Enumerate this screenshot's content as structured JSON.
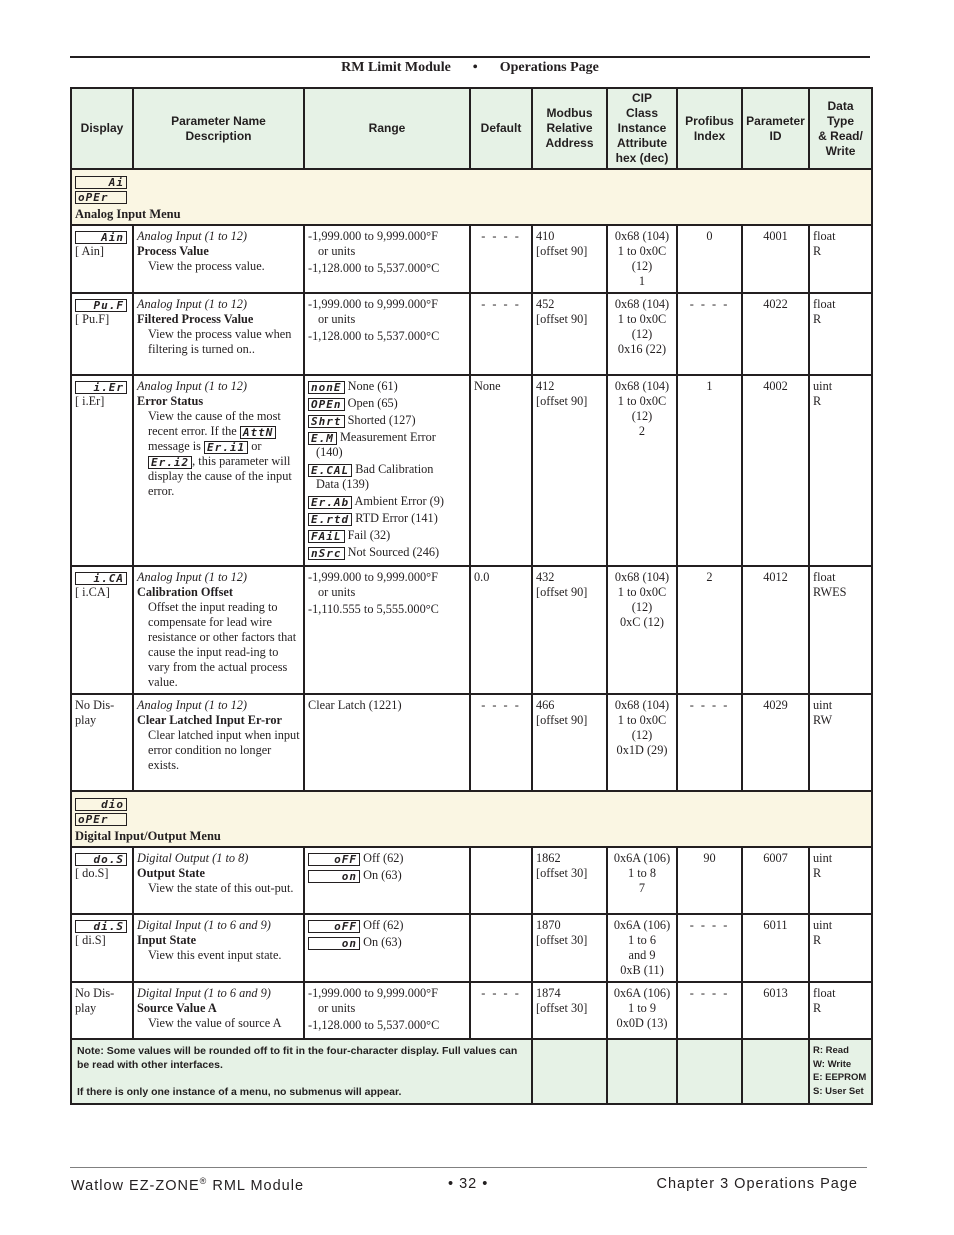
{
  "header": {
    "module": "RM Limit Module",
    "separator": "•",
    "page": "Operations Page"
  },
  "columns": {
    "display": "Display",
    "param_name_line1": "Parameter Name",
    "param_name_line2": "Description",
    "range": "Range",
    "default": "Default",
    "modbus": [
      "Modbus",
      "Relative",
      "Address"
    ],
    "cip": [
      "CIP",
      "Class",
      "Instance",
      "Attribute",
      "hex (dec)"
    ],
    "profibus": [
      "Profibus",
      "Index"
    ],
    "parameter_id": [
      "Parameter",
      "ID"
    ],
    "data_type": [
      "Data",
      "Type",
      "& Read/",
      "Write"
    ]
  },
  "menus": [
    {
      "lcd_top": "Ai",
      "lcd_bottom": "oPEr",
      "title": "Analog Input Menu"
    },
    {
      "lcd_top": "dio",
      "lcd_bottom": "oPEr",
      "title": "Digital Input/Output Menu"
    }
  ],
  "rows": [
    {
      "lcd": "Ain",
      "code": "[ Ain]",
      "group": "Analog Input (1 to 12)",
      "name": "Process Value",
      "desc": "View the process value.",
      "range": [
        "-1,999.000 to 9,999.000°F",
        "or units",
        "-1,128.000 to 5,537.000°C"
      ],
      "default": "- - - -",
      "modbus": [
        "410",
        "[offset 90]"
      ],
      "cip": [
        "0x68 (104)",
        "1 to 0x0C",
        "(12)",
        "1"
      ],
      "profibus": "0",
      "pid": "4001",
      "dtype": [
        "float",
        "R"
      ]
    },
    {
      "lcd": "Pu.F",
      "code": "[ Pu.F]",
      "group": "Analog Input (1 to 12)",
      "name": "Filtered Process Value",
      "desc": "View the process value when filtering is turned on..",
      "range": [
        "-1,999.000 to 9,999.000°F",
        "or units",
        "-1,128.000 to 5,537.000°C"
      ],
      "default": "- - - -",
      "modbus": [
        "452",
        "[offset 90]"
      ],
      "cip": [
        "0x68 (104)",
        "1 to 0x0C",
        "(12)",
        "0x16 (22)"
      ],
      "profibus": "- - - -",
      "pid": "4022",
      "dtype": [
        "float",
        "R"
      ]
    },
    {
      "lcd": "i.Er",
      "code": "[ i.Er]",
      "group": "Analog Input (1 to 12)",
      "name": "Error Status",
      "desc_parts": [
        "View the cause of the most recent error. If the ",
        "AttN",
        " message is ",
        "Er.i1",
        " or ",
        "Er.i2",
        ", this parameter will display the cause of the input error."
      ],
      "options": [
        {
          "lcd": "nonE",
          "label": "None (61)"
        },
        {
          "lcd": "OPEn",
          "label": "Open (65)"
        },
        {
          "lcd": "Shrt",
          "label": "Shorted (127)"
        },
        {
          "lcd": "E.M",
          "label": "Measurement Error",
          "cont": "(140)"
        },
        {
          "lcd": "E.CAL",
          "label": "Bad Calibration",
          "cont": "Data (139)"
        },
        {
          "lcd": "Er.Ab",
          "label": "Ambient Error (9)"
        },
        {
          "lcd": "E.rtd",
          "label": "RTD Error (141)"
        },
        {
          "lcd": "FAiL",
          "label": "Fail (32)"
        },
        {
          "lcd": "nSrc",
          "label": "Not Sourced (246)"
        }
      ],
      "default": "None",
      "modbus": [
        "412",
        "[offset 90]"
      ],
      "cip": [
        "0x68 (104)",
        "1 to 0x0C",
        "(12)",
        "2"
      ],
      "profibus": "1",
      "pid": "4002",
      "dtype": [
        "uint",
        "R"
      ]
    },
    {
      "lcd": "i.CA",
      "code": "[ i.CA]",
      "group": "Analog Input (1 to 12)",
      "name": "Calibration Offset",
      "desc": "Offset the input reading to compensate for lead wire resistance or other factors that cause the input read-ing to vary from the actual process value.",
      "range": [
        "-1,999.000 to 9,999.000°F",
        "or units",
        "-1,110.555 to 5,555.000°C"
      ],
      "default": "0.0",
      "modbus": [
        "432",
        "[offset 90]"
      ],
      "cip": [
        "0x68 (104)",
        "1 to 0x0C",
        "(12)",
        "0xC (12)"
      ],
      "profibus": "2",
      "pid": "4012",
      "dtype": [
        "float",
        "RWES"
      ]
    },
    {
      "display_text": "No Dis-play",
      "group": "Analog Input (1 to 12)",
      "name": "Clear Latched Input Er-ror",
      "desc": "Clear latched input when input error condition no longer exists.",
      "range_single": "Clear Latch (1221)",
      "default": "- - - -",
      "modbus": [
        "466",
        "[offset 90]"
      ],
      "cip": [
        "0x68 (104)",
        "1 to 0x0C",
        "(12)",
        "0x1D (29)"
      ],
      "profibus": "- - - -",
      "pid": "4029",
      "dtype": [
        "uint",
        "RW"
      ]
    },
    {
      "lcd": "do.S",
      "code": "[ do.S]",
      "group": "Digital Output (1 to 8)",
      "name": "Output State",
      "desc": "View the state of this out-put.",
      "options": [
        {
          "lcd": "oFF",
          "label": "Off (62)"
        },
        {
          "lcd": "on",
          "label": "On (63)"
        }
      ],
      "default": "",
      "modbus": [
        "1862",
        "[offset 30]"
      ],
      "cip": [
        "0x6A (106)",
        "1 to 8",
        "7"
      ],
      "profibus": "90",
      "pid": "6007",
      "dtype": [
        "uint",
        "R"
      ]
    },
    {
      "lcd": "di.S",
      "code": "[ di.S]",
      "group": "Digital Input (1 to 6 and 9)",
      "name": "Input State",
      "desc": "View this event input state.",
      "options": [
        {
          "lcd": "oFF",
          "label": "Off (62)"
        },
        {
          "lcd": "on",
          "label": "On (63)"
        }
      ],
      "default": "",
      "modbus": [
        "1870",
        "[offset 30]"
      ],
      "cip": [
        "0x6A (106)",
        "1 to 6",
        "and 9",
        "0xB (11)"
      ],
      "profibus": "- - - -",
      "pid": "6011",
      "dtype": [
        "uint",
        "R"
      ]
    },
    {
      "display_text": "No Dis-play",
      "group": "Digital Input (1 to 6 and 9)",
      "name": "Source Value A",
      "desc": "View the value of source A",
      "range": [
        "-1,999.000 to 9,999.000°F",
        "or units",
        "-1,128.000 to 5,537.000°C"
      ],
      "default": "- - - -",
      "modbus": [
        "1874",
        "[offset 30]"
      ],
      "cip": [
        "0x6A (106)",
        "1 to 9",
        "0x0D (13)"
      ],
      "profibus": "- - - -",
      "pid": "6013",
      "dtype": [
        "float",
        "R"
      ]
    }
  ],
  "note": {
    "line1": "Note: Some values will be rounded off to fit in the four-character display. Full values can be read with other interfaces.",
    "line2": "If there is only one instance of a menu, no submenus will appear.",
    "legend": [
      "R: Read",
      "W: Write",
      "E: EEPROM",
      "S: User Set"
    ]
  },
  "footer": {
    "left": "Watlow EZ-ZONE",
    "registered": "®",
    "left_suffix": " RML Module",
    "center": "•  32  •",
    "right": "Chapter 3 Operations Page"
  },
  "colors": {
    "header_fill": "#e6f2e6",
    "menu_fill": "#faf6e3",
    "border": "#231f20"
  }
}
